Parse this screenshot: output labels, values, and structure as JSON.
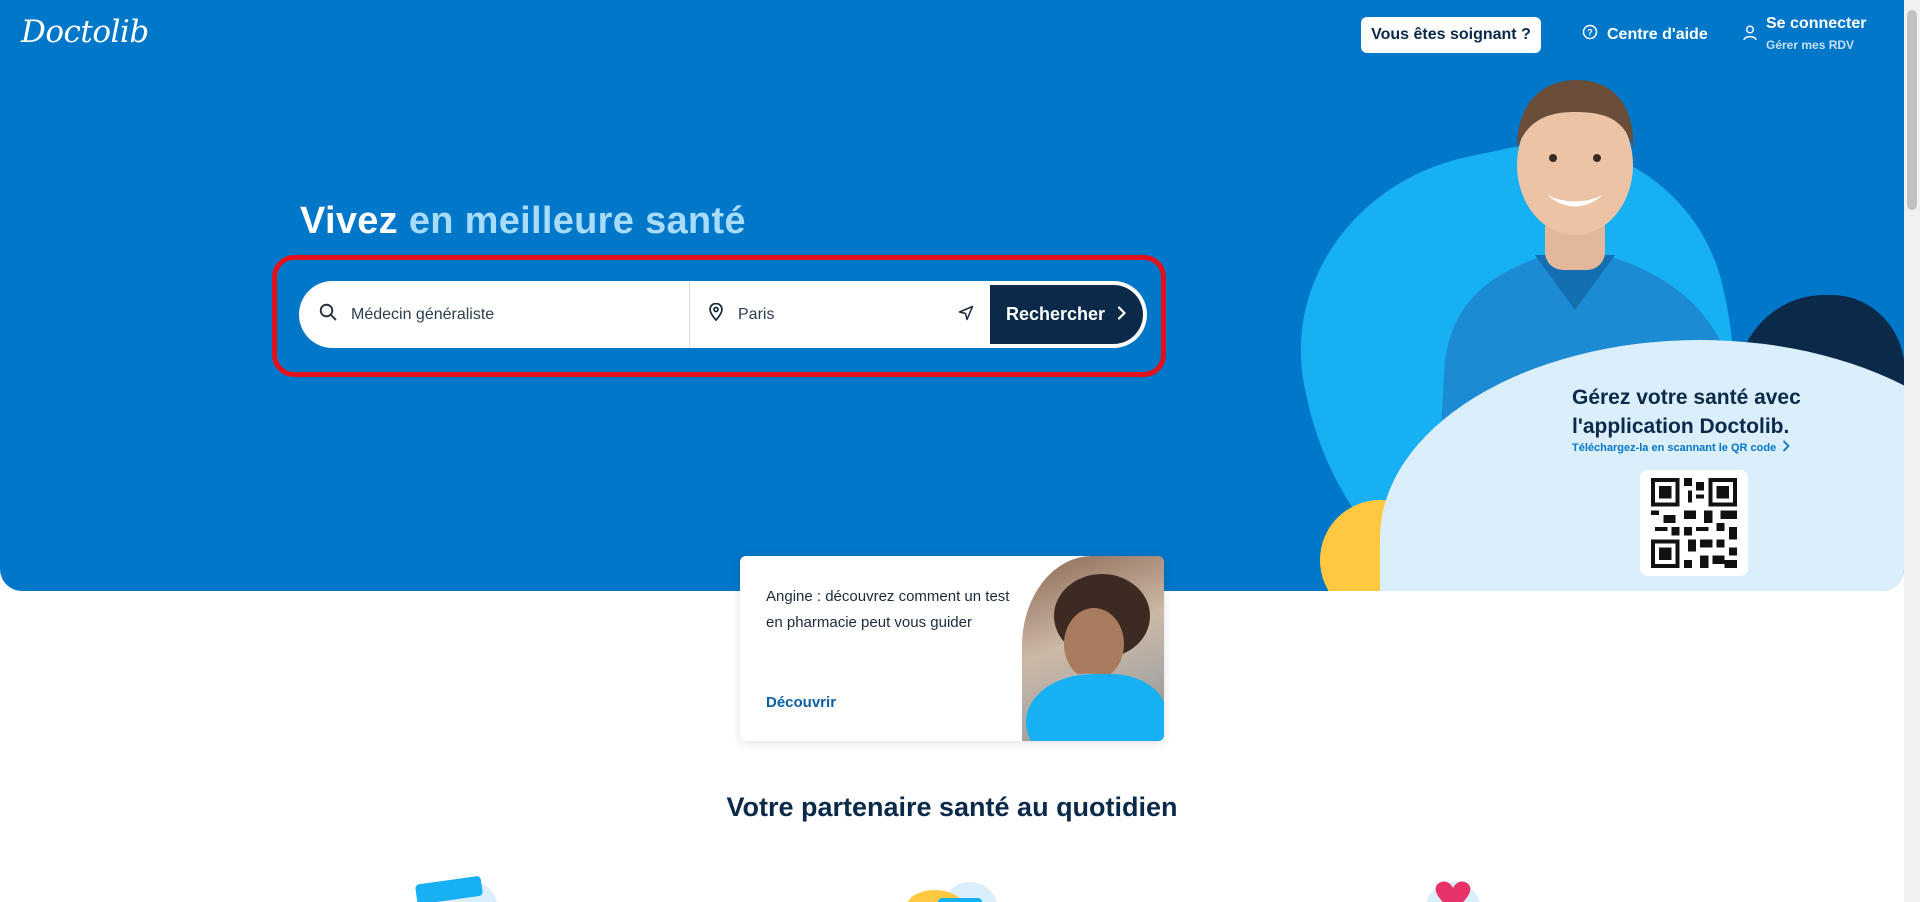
{
  "header": {
    "logo": "Doctolib",
    "pro_button": "Vous êtes soignant ?",
    "help_label": "Centre d'aide",
    "login_label": "Se connecter",
    "login_sub": "Gérer mes RDV"
  },
  "hero": {
    "headline_part1": "Vivez",
    "headline_part2": "en meilleure santé",
    "search": {
      "what_value": "Médecin généraliste",
      "where_value": "Paris",
      "button_label": "Rechercher"
    },
    "app_promo": {
      "title": "Gérez votre santé avec l'application Doctolib.",
      "subtitle": "Téléchargez-la en scannant le QR code"
    }
  },
  "article_card": {
    "text": "Angine : découvrez comment un test en pharmacie peut vous guider",
    "link": "Découvrir"
  },
  "section": {
    "title": "Votre partenaire santé au quotidien"
  },
  "colors": {
    "brand_blue": "#0077c8",
    "navy": "#0b2a4a",
    "light_blue": "#17b0f2",
    "highlight_red": "#e3111b",
    "yellow": "#ffc840"
  }
}
